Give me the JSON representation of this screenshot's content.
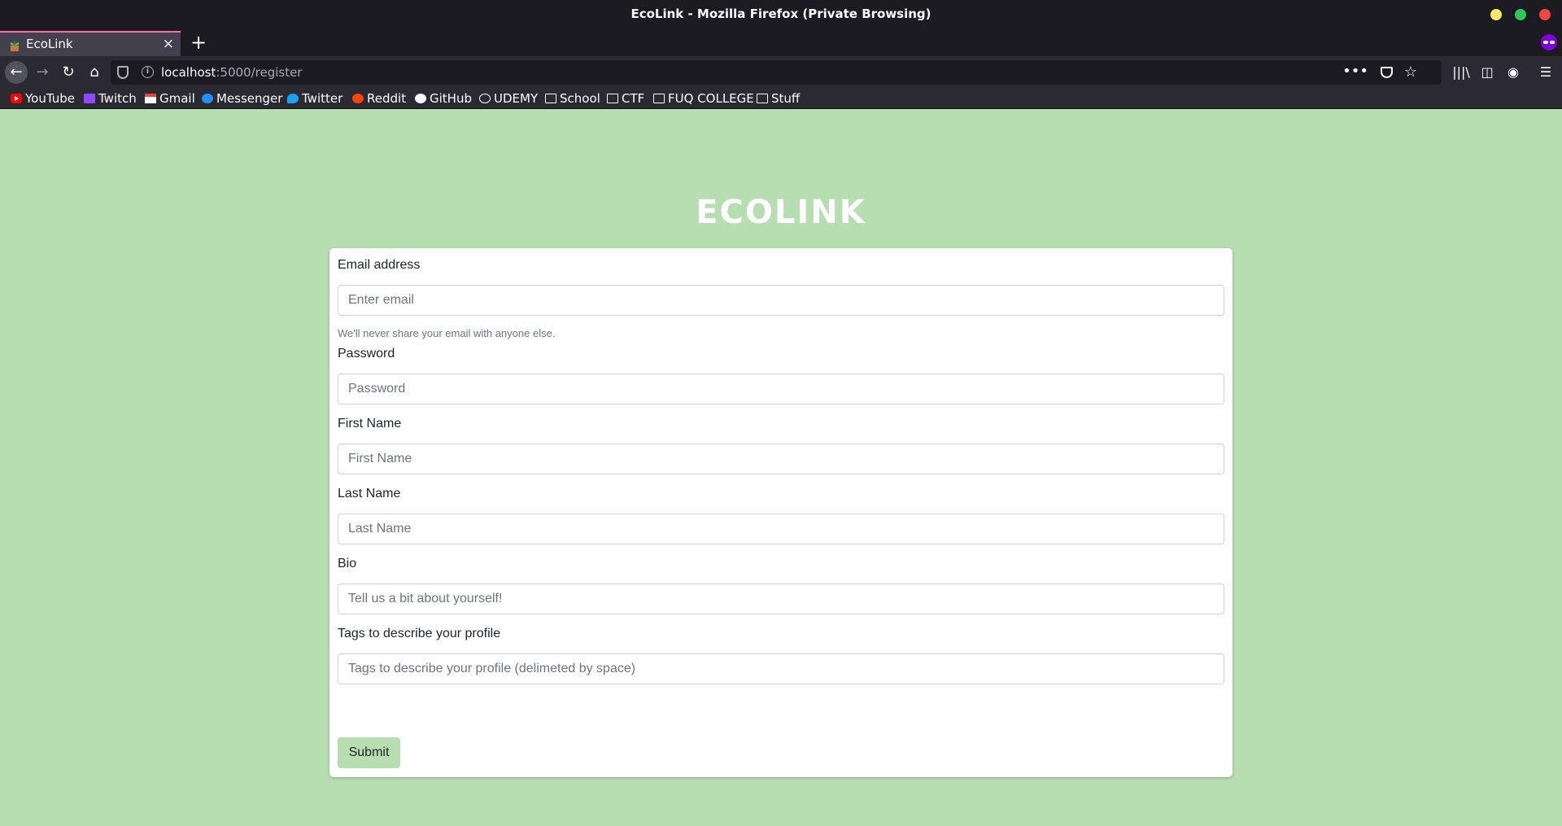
{
  "window": {
    "title": "EcoLink - Mozilla Firefox (Private Browsing)",
    "controls": [
      "minimize",
      "maximize",
      "close"
    ],
    "control_colors": {
      "minimize": "#f4e96b",
      "maximize": "#2fc75b",
      "close": "#ee4545"
    }
  },
  "tabs": [
    {
      "title": "EcoLink",
      "close": "×",
      "active": true
    }
  ],
  "newtab_label": "+",
  "nav": {
    "back": "←",
    "forward": "→",
    "reload": "↻",
    "home": "⌂",
    "url_host": "localhost",
    "url_path": ":5000/register",
    "page_actions": "•••",
    "star": "☆",
    "library": "|||\\",
    "sidebar": "◫",
    "account": "◉",
    "menu": "☰"
  },
  "bookmarks": [
    {
      "label": "YouTube",
      "icon": "youtube-icon"
    },
    {
      "label": "Twitch",
      "icon": "twitch-icon"
    },
    {
      "label": "Gmail",
      "icon": "gmail-icon"
    },
    {
      "label": "Messenger",
      "icon": "messenger-icon"
    },
    {
      "label": "Twitter",
      "icon": "twitter-icon"
    },
    {
      "label": "Reddit",
      "icon": "reddit-icon"
    },
    {
      "label": "GitHub",
      "icon": "github-icon"
    },
    {
      "label": "UDEMY",
      "icon": "globe-icon"
    },
    {
      "label": "School",
      "icon": "folder-icon"
    },
    {
      "label": "CTF",
      "icon": "folder-icon"
    },
    {
      "label": "FUQ COLLEGE",
      "icon": "folder-icon"
    },
    {
      "label": "Stuff",
      "icon": "folder-icon"
    }
  ],
  "page": {
    "logo": "ECOLINK",
    "background_color": "#b6deb0",
    "form": {
      "email": {
        "label": "Email address",
        "placeholder": "Enter email",
        "help": "We'll never share your email with anyone else."
      },
      "password": {
        "label": "Password",
        "placeholder": "Password"
      },
      "first_name": {
        "label": "First Name",
        "placeholder": "First Name"
      },
      "last_name": {
        "label": "Last Name",
        "placeholder": "Last Name"
      },
      "bio": {
        "label": "Bio",
        "placeholder": "Tell us a bit about yourself!"
      },
      "tags": {
        "label": "Tags to describe your profile",
        "placeholder": "Tags to describe your profile (delimeted by space)"
      },
      "submit_label": "Submit"
    }
  }
}
